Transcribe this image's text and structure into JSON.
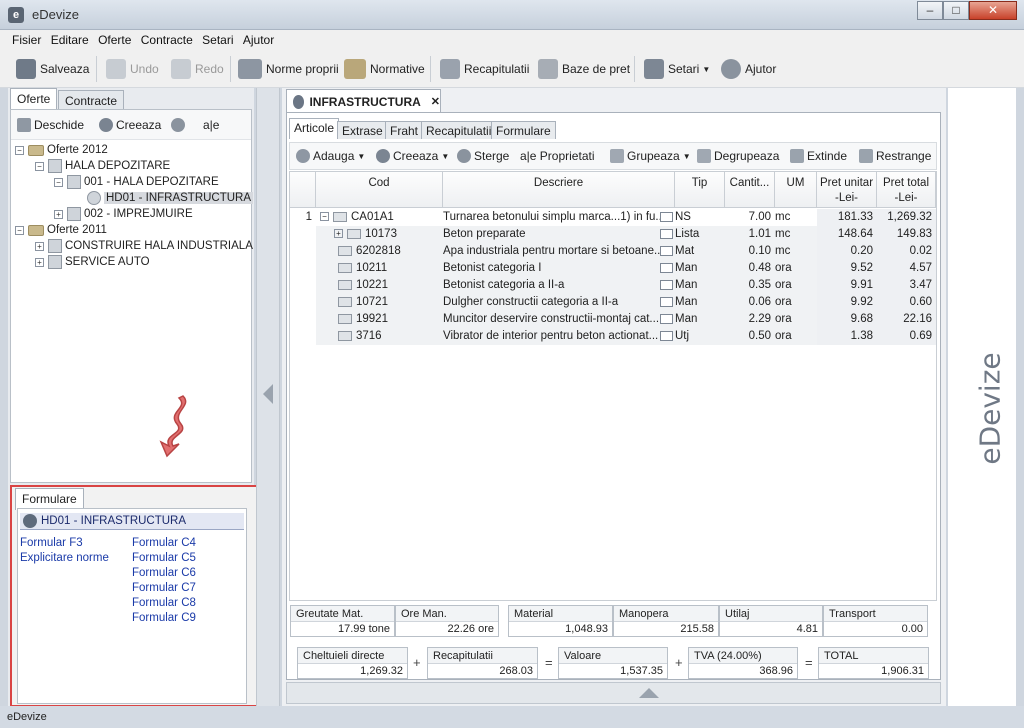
{
  "window": {
    "title": "eDevize"
  },
  "menu": [
    "Fisier",
    "Editare",
    "Oferte",
    "Contracte",
    "Setari",
    "Ajutor"
  ],
  "toolbar": {
    "save": "Salveaza",
    "undo": "Undo",
    "redo": "Redo",
    "norme": "Norme proprii",
    "normative": "Normative",
    "recap": "Recapitulatii",
    "baze": "Baze de pret",
    "setari": "Setari",
    "ajutor": "Ajutor"
  },
  "left_tabs": [
    "Oferte",
    "Contracte"
  ],
  "tree_tools": {
    "open": "Deschide",
    "create": "Creeaza",
    "ae": "a|e"
  },
  "tree": [
    {
      "label": "Oferte 2012"
    },
    {
      "label": "HALA DEPOZITARE"
    },
    {
      "label": "001 - HALA DEPOZITARE"
    },
    {
      "label": "HD01 - INFRASTRUCTURA"
    },
    {
      "label": "002 - IMPREJMUIRE"
    },
    {
      "label": "Oferte 2011"
    },
    {
      "label": "CONSTRUIRE HALA INDUSTRIALA"
    },
    {
      "label": "SERVICE AUTO"
    }
  ],
  "formulare": {
    "tab": "Formulare",
    "header": "HD01 - INFRASTRUCTURA",
    "col1": [
      "Formular F3",
      "Explicitare norme"
    ],
    "col2": [
      "Formular C4",
      "Formular C5",
      "Formular C6",
      "Formular C7",
      "Formular C8",
      "Formular C9"
    ]
  },
  "main_tab": "INFRASTRUCTURA",
  "sub_tabs": [
    "Articole",
    "Extrase",
    "Fraht",
    "Recapitulatii",
    "Formulare"
  ],
  "grid_tools": {
    "add": "Adauga",
    "create": "Creeaza",
    "delete": "Sterge",
    "props": "a|e Proprietati",
    "group": "Grupeaza",
    "ungroup": "Degrupeaza",
    "expand": "Extinde",
    "collapse": "Restrange"
  },
  "columns": {
    "cod": "Cod",
    "descriere": "Descriere",
    "tip": "Tip",
    "cant": "Cantit...",
    "um": "UM",
    "pu": "Pret unitar",
    "pu2": "-Lei-",
    "pt": "Pret total",
    "pt2": "-Lei-"
  },
  "rows": [
    {
      "num": "1",
      "cod": "CA01A1",
      "desc": "Turnarea betonului simplu marca...1) in fu...",
      "tip": "NS",
      "cant": "7.00",
      "um": "mc",
      "pu": "181.33",
      "pt": "1,269.32"
    },
    {
      "num": "",
      "cod": "10173",
      "desc": "Beton preparate",
      "tip": "Lista",
      "cant": "1.01",
      "um": "mc",
      "pu": "148.64",
      "pt": "149.83"
    },
    {
      "num": "",
      "cod": "6202818",
      "desc": "Apa industriala pentru mortare si betoane...",
      "tip": "Mat",
      "cant": "0.10",
      "um": "mc",
      "pu": "0.20",
      "pt": "0.02"
    },
    {
      "num": "",
      "cod": "10211",
      "desc": "Betonist categoria I",
      "tip": "Man",
      "cant": "0.48",
      "um": "ora",
      "pu": "9.52",
      "pt": "4.57"
    },
    {
      "num": "",
      "cod": "10221",
      "desc": "Betonist categoria a II-a",
      "tip": "Man",
      "cant": "0.35",
      "um": "ora",
      "pu": "9.91",
      "pt": "3.47"
    },
    {
      "num": "",
      "cod": "10721",
      "desc": "Dulgher constructii categoria a II-a",
      "tip": "Man",
      "cant": "0.06",
      "um": "ora",
      "pu": "9.92",
      "pt": "0.60"
    },
    {
      "num": "",
      "cod": "19921",
      "desc": "Muncitor deservire constructii-montaj cat...",
      "tip": "Man",
      "cant": "2.29",
      "um": "ora",
      "pu": "9.68",
      "pt": "22.16"
    },
    {
      "num": "",
      "cod": "3716",
      "desc": "Vibrator de interior pentru beton actionat...",
      "tip": "Utj",
      "cant": "0.50",
      "um": "ora",
      "pu": "1.38",
      "pt": "0.69"
    }
  ],
  "summary1": [
    {
      "label": "Greutate Mat.",
      "value": "17.99 tone"
    },
    {
      "label": "Ore Man.",
      "value": "22.26 ore"
    },
    {
      "label": "Material",
      "value": "1,048.93"
    },
    {
      "label": "Manopera",
      "value": "215.58"
    },
    {
      "label": "Utilaj",
      "value": "4.81"
    },
    {
      "label": "Transport",
      "value": "0.00"
    }
  ],
  "summary2": [
    {
      "label": "Cheltuieli directe",
      "value": "1,269.32"
    },
    {
      "label": "Recapitulatii",
      "value": "268.03"
    },
    {
      "label": "Valoare",
      "value": "1,537.35"
    },
    {
      "label": "TVA (24.00%)",
      "value": "368.96"
    },
    {
      "label": "TOTAL",
      "value": "1,906.31"
    }
  ],
  "ops": [
    "+",
    "=",
    "+",
    "="
  ],
  "brand": "eDevize",
  "status": "eDevize"
}
